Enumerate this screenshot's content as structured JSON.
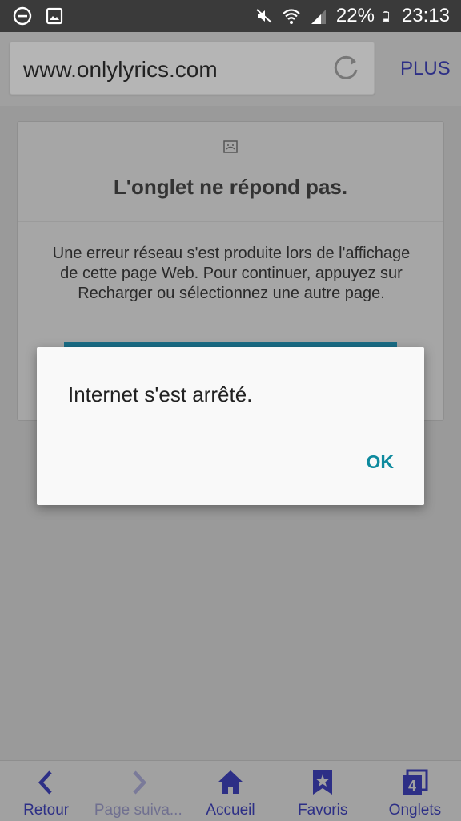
{
  "status_bar": {
    "battery": "22%",
    "time": "23:13"
  },
  "toolbar": {
    "url": "www.onlylyrics.com",
    "more_label": "PLUS"
  },
  "error_card": {
    "title": "L'onglet ne répond pas.",
    "message": "Une erreur réseau s'est produite lors de l'affichage de cette page Web. Pour continuer, appuyez sur Recharger ou sélectionnez une autre page."
  },
  "dialog": {
    "message": "Internet s'est arrêté.",
    "ok_label": "OK"
  },
  "bottom_nav": {
    "items": [
      {
        "label": "Retour",
        "icon": "back-arrow-icon"
      },
      {
        "label": "Page suiva...",
        "icon": "forward-arrow-icon"
      },
      {
        "label": "Accueil",
        "icon": "home-icon"
      },
      {
        "label": "Favoris",
        "icon": "bookmark-star-icon"
      },
      {
        "label": "Onglets",
        "icon": "tabs-icon",
        "count": "4"
      }
    ]
  },
  "colors": {
    "accent": "#2d2f86",
    "dialog_ok": "#0e8a9e",
    "overlay": "#9a9a9a"
  }
}
